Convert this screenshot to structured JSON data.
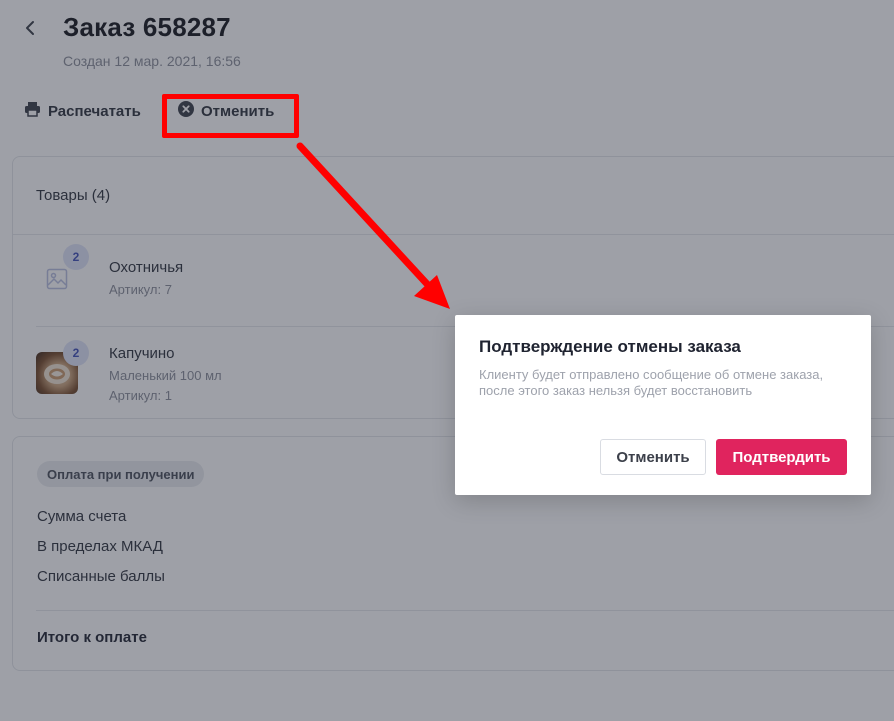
{
  "header": {
    "title": "Заказ 658287",
    "subtitle": "Создан 12 мар. 2021, 16:56"
  },
  "toolbar": {
    "print_label": "Распечатать",
    "cancel_label": "Отменить"
  },
  "products": {
    "header": "Товары (4)",
    "items": [
      {
        "qty": "2",
        "name": "Охотничья",
        "meta": [
          "Артикул: 7"
        ],
        "image": "placeholder-image-icon"
      },
      {
        "qty": "2",
        "name": "Капучино",
        "meta": [
          "Маленький 100 мл",
          "Артикул: 1"
        ],
        "image": "cappuccino-photo"
      }
    ]
  },
  "payment": {
    "badge": "Оплата при получении",
    "lines": [
      "Сумма счета",
      "В пределах МКАД",
      "Списанные баллы"
    ],
    "total_label": "Итого к оплате"
  },
  "modal": {
    "title": "Подтверждение отмены заказа",
    "text": "Клиенту будет отправлено сообщение об отмене заказа, после этого заказ нельзя будет восстановить",
    "cancel_label": "Отменить",
    "confirm_label": "Подтвердить"
  },
  "colors": {
    "accent": "#e0245e",
    "annotation": "#ff0000",
    "badge_bg": "#dfe3f7",
    "badge_text": "#4150b8"
  }
}
